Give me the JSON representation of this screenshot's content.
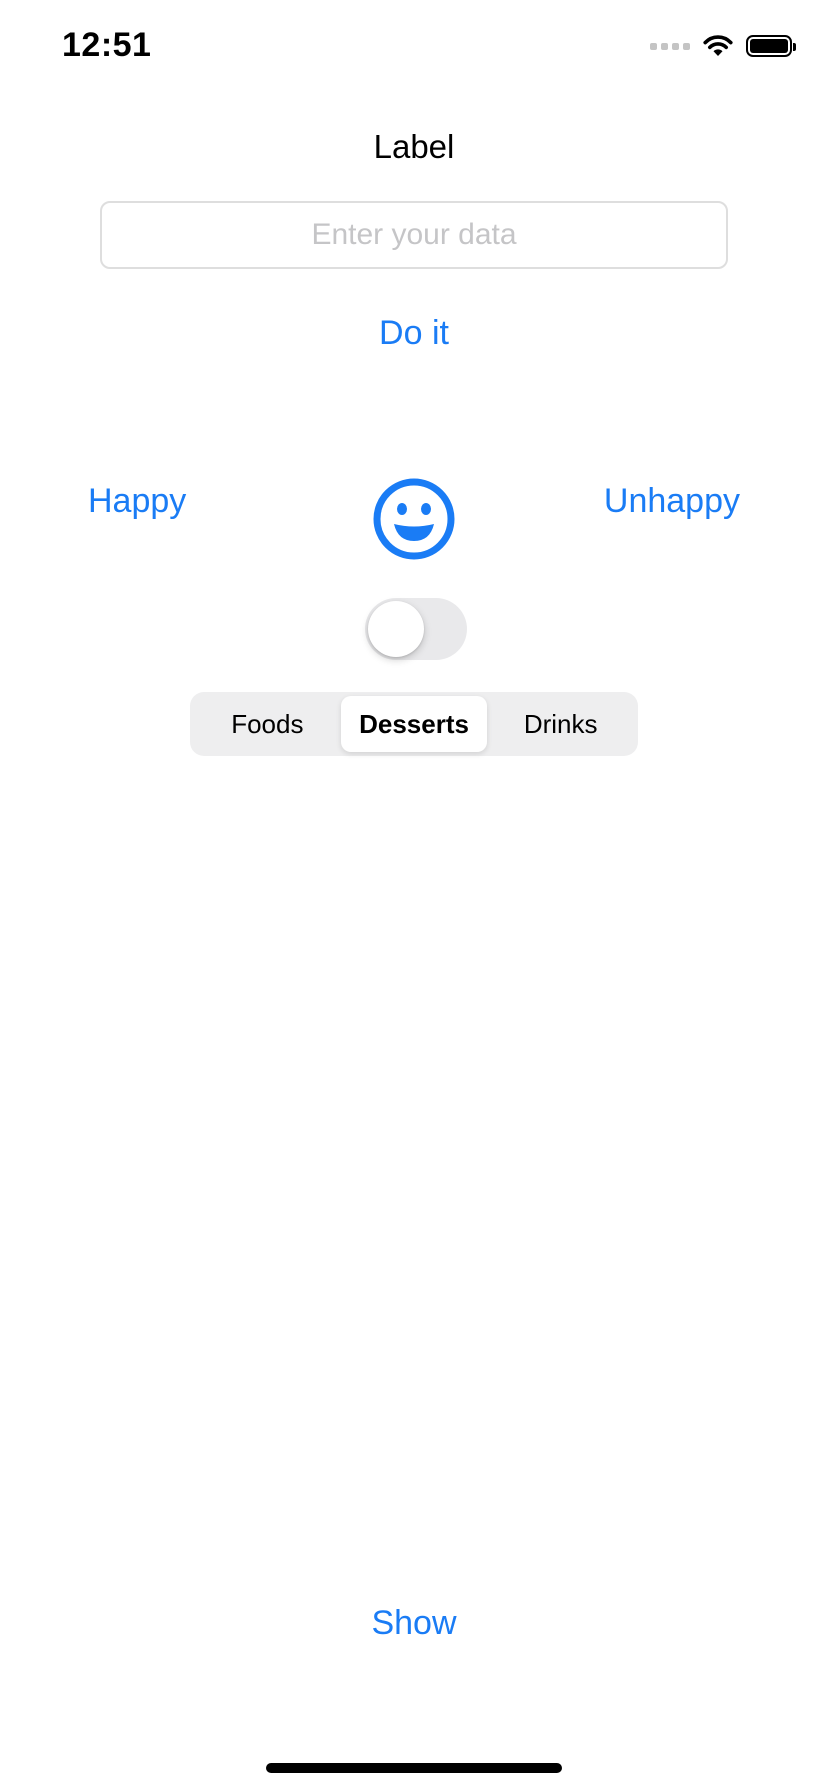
{
  "status_bar": {
    "time": "12:51",
    "icons": [
      "signal-dots-icon",
      "wifi-icon",
      "battery-icon"
    ]
  },
  "main": {
    "title": "Label",
    "input": {
      "placeholder": "Enter your data",
      "value": ""
    },
    "do_it_label": "Do it",
    "happy_label": "Happy",
    "unhappy_label": "Unhappy",
    "emoji_icon": "smiley-face-icon",
    "toggle": {
      "on": false
    },
    "segmented": {
      "items": [
        "Foods",
        "Desserts",
        "Drinks"
      ],
      "selected": "Desserts"
    },
    "show_label": "Show"
  },
  "colors": {
    "accent": "#1a7cf5",
    "toggle_off_track": "#e9e9eb",
    "segment_background": "#eeeeef",
    "placeholder": "#c5c5c7"
  }
}
